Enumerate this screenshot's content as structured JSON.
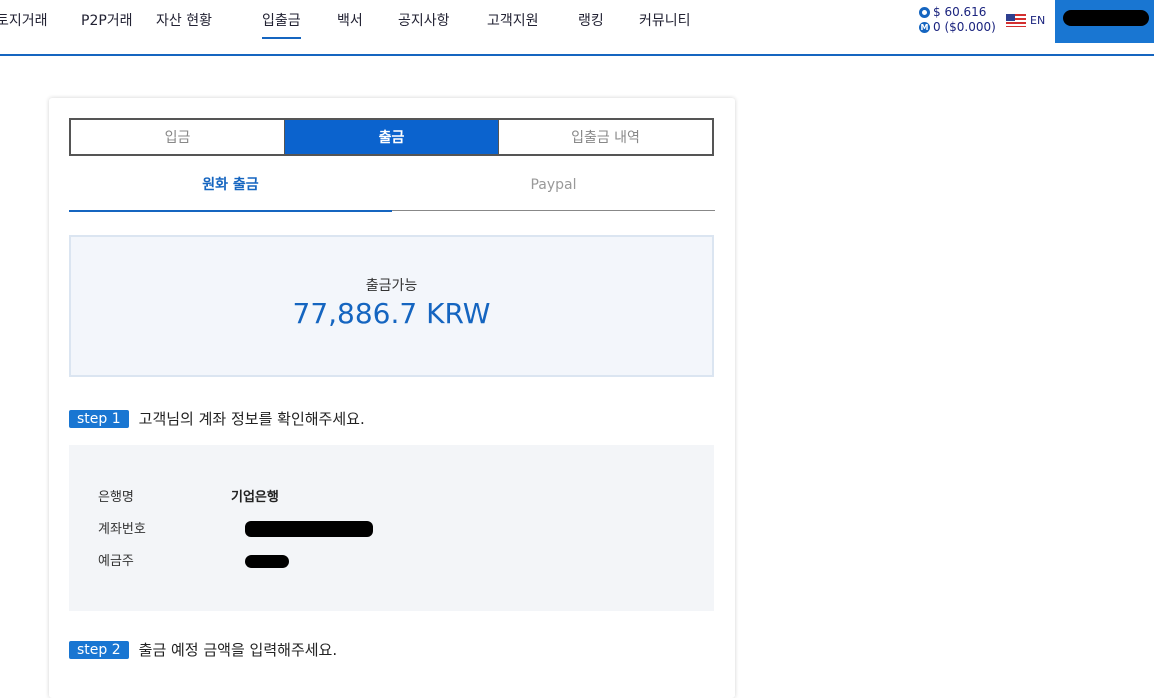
{
  "nav": {
    "items": [
      {
        "label": "토지거래"
      },
      {
        "label": "P2P거래"
      },
      {
        "label": "자산 현황"
      },
      {
        "label": "입출금"
      },
      {
        "label": "백서"
      },
      {
        "label": "공지사항"
      },
      {
        "label": "고객지원"
      },
      {
        "label": "랭킹"
      },
      {
        "label": "커뮤니티"
      }
    ],
    "wallet_usd": "$ 60.616",
    "wallet_coin": "0 ($0.000)",
    "lang": "EN",
    "accent": "#1565c0"
  },
  "tabs": {
    "main": [
      {
        "label": "입금"
      },
      {
        "label": "출금"
      },
      {
        "label": "입출금 내역"
      }
    ],
    "sub": [
      {
        "label": "원화 출금"
      },
      {
        "label": "Paypal"
      }
    ]
  },
  "balance": {
    "label": "출금가능",
    "amount": "77,886.7 KRW"
  },
  "step1": {
    "badge": "step 1",
    "text": "고객님의 계좌 정보를 확인해주세요."
  },
  "account": {
    "bank_label": "은행명",
    "bank_value": "기업은행",
    "number_label": "계좌번호",
    "holder_label": "예금주"
  },
  "step2": {
    "badge": "step 2",
    "text": "출금 예정 금액을 입력해주세요."
  }
}
